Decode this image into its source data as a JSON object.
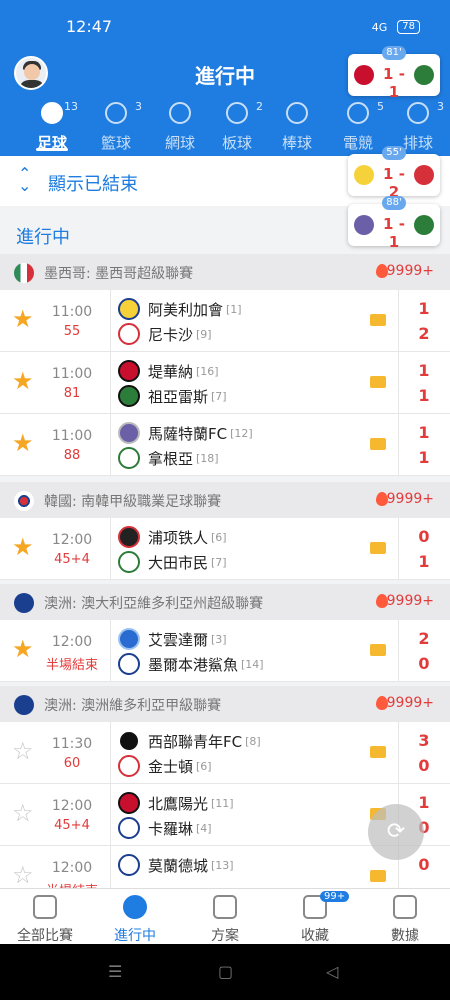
{
  "status": {
    "time": "12:47",
    "battery": "78",
    "signal": "4G"
  },
  "header": {
    "title": "進行中"
  },
  "tabs": [
    {
      "label": "足球",
      "count": "13",
      "active": true
    },
    {
      "label": "籃球",
      "count": "3"
    },
    {
      "label": "網球",
      "count": ""
    },
    {
      "label": "板球",
      "count": "2"
    },
    {
      "label": "棒球",
      "count": ""
    },
    {
      "label": "電競",
      "count": "5"
    },
    {
      "label": "排球",
      "count": "3"
    }
  ],
  "show_finished": "顯示已結束",
  "section_title": "進行中",
  "popups": [
    {
      "minute": "81'",
      "score": "1 - 1"
    },
    {
      "minute": "55'",
      "score": "1 - 2"
    },
    {
      "minute": "88'",
      "score": "1 - 1"
    }
  ],
  "leagues": [
    {
      "name": "墨西哥: 墨西哥超級聯賽",
      "hot": "9999+",
      "flag_color": "#2e8b57"
    },
    {
      "name": "韓國: 南韓甲級職業足球聯賽",
      "hot": "9999+",
      "flag_color": "#ffffff"
    },
    {
      "name": "澳洲: 澳大利亞維多利亞州超級聯賽",
      "hot": "9999+",
      "flag_color": "#1b3f8f"
    },
    {
      "name": "澳洲: 澳洲維多利亞甲級聯賽",
      "hot": "9999+",
      "flag_color": "#1b3f8f"
    }
  ],
  "matches": [
    {
      "time": "11:00",
      "minute": "55",
      "home": "阿美利加會",
      "home_rank": "[1]",
      "away": "尼卡沙",
      "away_rank": "[9]",
      "hs": "1",
      "as": "2",
      "fav": true
    },
    {
      "time": "11:00",
      "minute": "81",
      "home": "堤華納",
      "home_rank": "[16]",
      "away": "祖亞雷斯",
      "away_rank": "[7]",
      "hs": "1",
      "as": "1",
      "fav": true
    },
    {
      "time": "11:00",
      "minute": "88",
      "home": "馬薩特蘭FC",
      "home_rank": "[12]",
      "away": "拿根亞",
      "away_rank": "[18]",
      "hs": "1",
      "as": "1",
      "fav": true
    },
    {
      "time": "12:00",
      "minute": "45+4",
      "home": "浦项铁人",
      "home_rank": "[6]",
      "away": "大田市民",
      "away_rank": "[7]",
      "hs": "0",
      "as": "1",
      "fav": true
    },
    {
      "time": "12:00",
      "minute": "半場結束",
      "home": "艾雲達爾",
      "home_rank": "[3]",
      "away": "墨爾本港鯊魚",
      "away_rank": "[14]",
      "hs": "2",
      "as": "0",
      "fav": true
    },
    {
      "time": "11:30",
      "minute": "60",
      "home": "西部聯青年FC",
      "home_rank": "[8]",
      "away": "金士頓",
      "away_rank": "[6]",
      "hs": "3",
      "as": "0",
      "fav": false
    },
    {
      "time": "12:00",
      "minute": "45+4",
      "home": "北鷹陽光",
      "home_rank": "[11]",
      "away": "卡羅琳",
      "away_rank": "[4]",
      "hs": "1",
      "as": "0",
      "fav": false
    },
    {
      "time": "12:00",
      "minute": "半場結束",
      "home": "莫蘭德城",
      "home_rank": "[13]",
      "away": "",
      "away_rank": "",
      "hs": "0",
      "as": "",
      "fav": false
    }
  ],
  "bottom_nav": [
    {
      "label": "全部比賽"
    },
    {
      "label": "進行中",
      "active": true
    },
    {
      "label": "方案"
    },
    {
      "label": "收藏",
      "badge": "99+"
    },
    {
      "label": "數據"
    }
  ]
}
